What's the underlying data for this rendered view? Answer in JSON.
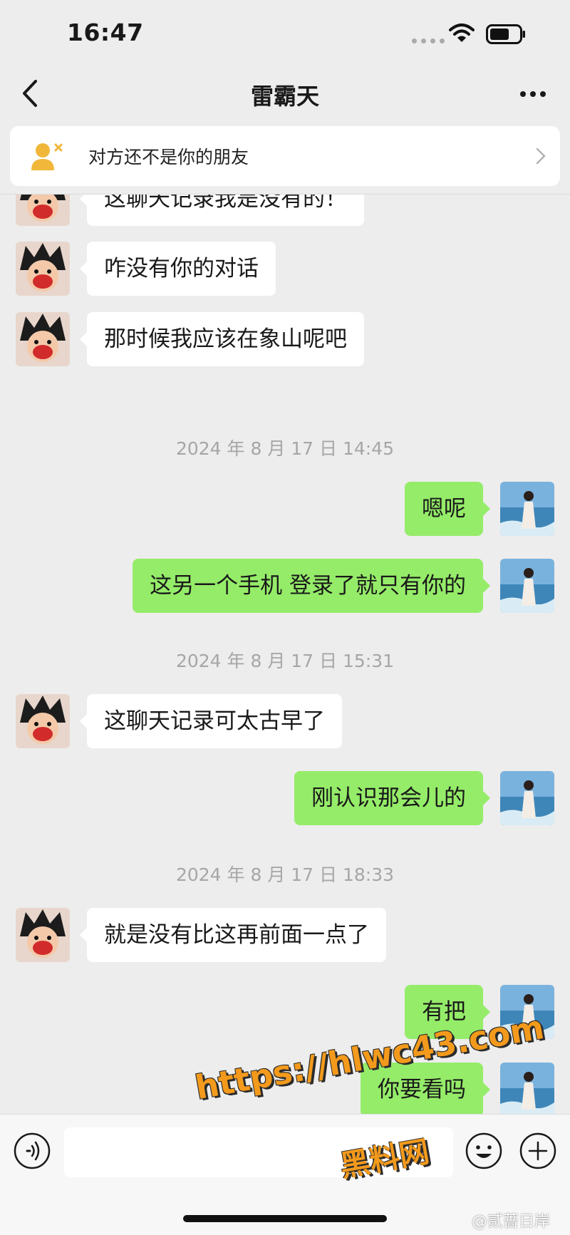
{
  "status_bar": {
    "time": "16:47"
  },
  "nav": {
    "title": "雷霸天"
  },
  "banner": {
    "text": "对方还不是你的朋友"
  },
  "messages": [
    {
      "side": "left",
      "text": "这聊天记录我是没有的！"
    },
    {
      "side": "left",
      "text": "咋没有你的对话"
    },
    {
      "side": "left",
      "text": "那时候我应该在象山呢吧"
    },
    {
      "side": "time",
      "text": "2024 年 8 月 17 日 14:45"
    },
    {
      "side": "right",
      "text": "嗯呢"
    },
    {
      "side": "right",
      "text": "这另一个手机 登录了就只有你的"
    },
    {
      "side": "time",
      "text": "2024 年 8 月 17 日 15:31"
    },
    {
      "side": "left",
      "text": "这聊天记录可太古早了"
    },
    {
      "side": "right",
      "text": "刚认识那会儿的"
    },
    {
      "side": "time",
      "text": "2024 年 8 月 17 日 18:33"
    },
    {
      "side": "left",
      "text": "就是没有比这再前面一点了"
    },
    {
      "side": "right",
      "text": "有把"
    },
    {
      "side": "right",
      "text": "你要看吗"
    }
  ],
  "input": {
    "value": ""
  },
  "watermark": {
    "url": "https://hlwc43.com",
    "site_name": "黑料网",
    "weibo": "@贰蔷日岸"
  }
}
